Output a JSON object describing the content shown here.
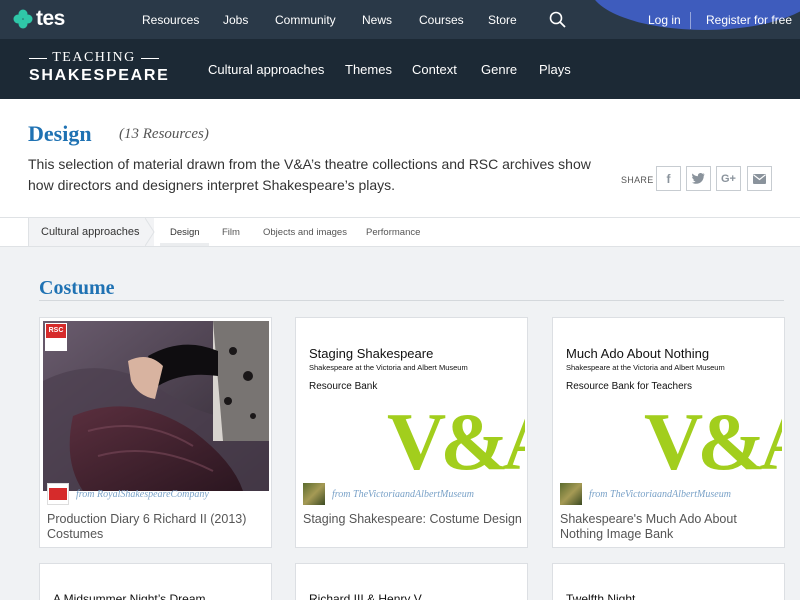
{
  "tes": {
    "logo": "tes",
    "nav": [
      "Resources",
      "Jobs",
      "Community",
      "News",
      "Courses",
      "Store"
    ],
    "login": "Log in",
    "register": "Register for free"
  },
  "brand": {
    "top": "TEACHING",
    "bottom": "SHAKESPEARE"
  },
  "main_nav": [
    "Cultural approaches",
    "Themes",
    "Context",
    "Genre",
    "Plays"
  ],
  "page": {
    "title": "Design",
    "count": "(13 Resources)",
    "description": "This selection of material drawn from the V&A’s theatre collections and RSC archives show how directors and designers interpret Shakespeare’s plays.",
    "share_label": "SHARE",
    "share_icons": [
      "facebook-icon",
      "twitter-icon",
      "google-plus-icon",
      "email-icon"
    ]
  },
  "tabs": {
    "parent": "Cultural approaches",
    "items": [
      "Design",
      "Film",
      "Objects and images",
      "Performance"
    ],
    "active": "Design"
  },
  "section": {
    "title": "Costume"
  },
  "cards": [
    {
      "rsc_badge": "RSC",
      "from": "from RoyalShakespeareCompany",
      "caption": "Production Diary 6 Richard II (2013) Costumes"
    },
    {
      "thumb_title": "Staging Shakespeare",
      "thumb_sub": "Shakespeare at the Victoria and Albert Museum",
      "thumb_rb": "Resource Bank",
      "logo": "V&A",
      "from": "from TheVictoriaandAlbertMuseum",
      "caption": "Staging Shakespeare: Costume Design"
    },
    {
      "thumb_title": "Much Ado About Nothing",
      "thumb_sub": "Shakespeare at the Victoria and Albert Museum",
      "thumb_rb": "Resource Bank for Teachers",
      "logo": "V&A",
      "from": "from TheVictoriaandAlbertMuseum",
      "caption": "Shakespeare's Much Ado About Nothing Image Bank"
    }
  ],
  "next_cards": [
    "A Midsummer Night’s Dream",
    "Richard III & Henry V",
    "Twelfth Night"
  ]
}
